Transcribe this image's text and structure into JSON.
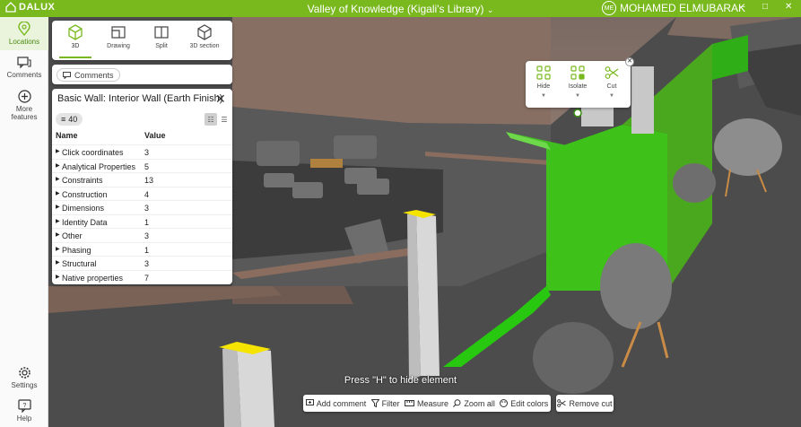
{
  "app": {
    "brand": "DALUX",
    "title": "Valley of Knowledge (Kigali's Library)",
    "user_initials": "ME",
    "user_name": "MOHAMED ELMUBARAK",
    "accent_color": "#79b91e"
  },
  "sidebar": {
    "items": [
      {
        "label": "Locations",
        "icon": "location-pin-icon"
      },
      {
        "label": "Comments",
        "icon": "comment-icon"
      },
      {
        "label": "More features",
        "icon": "plus-circle-icon"
      },
      {
        "label": "Settings",
        "icon": "gear-icon"
      },
      {
        "label": "Help",
        "icon": "help-icon"
      }
    ]
  },
  "view_modes": [
    {
      "label": "3D",
      "icon": "cube-icon"
    },
    {
      "label": "Drawing",
      "icon": "drawing-icon"
    },
    {
      "label": "Split",
      "icon": "split-icon"
    },
    {
      "label": "3D section",
      "icon": "section-cube-icon"
    }
  ],
  "comments_label": "Comments",
  "properties": {
    "title": "Basic Wall: Interior Wall (Earth Finish)",
    "count": "40",
    "col_name": "Name",
    "col_value": "Value",
    "rows": [
      {
        "name": "Click coordinates",
        "value": "3"
      },
      {
        "name": "Analytical Properties",
        "value": "5"
      },
      {
        "name": "Constraints",
        "value": "13"
      },
      {
        "name": "Construction",
        "value": "4"
      },
      {
        "name": "Dimensions",
        "value": "3"
      },
      {
        "name": "Identity Data",
        "value": "1"
      },
      {
        "name": "Other",
        "value": "3"
      },
      {
        "name": "Phasing",
        "value": "1"
      },
      {
        "name": "Structural",
        "value": "3"
      },
      {
        "name": "Native properties",
        "value": "7"
      }
    ]
  },
  "element_actions": {
    "hide": "Hide",
    "isolate": "Isolate",
    "cut": "Cut"
  },
  "hint": "Press \"H\" to hide element",
  "toolbar": {
    "add_comment": "Add comment",
    "filter": "Filter",
    "measure": "Measure",
    "zoom_all": "Zoom all",
    "edit_colors": "Edit colors",
    "remove_cut": "Remove cut"
  }
}
